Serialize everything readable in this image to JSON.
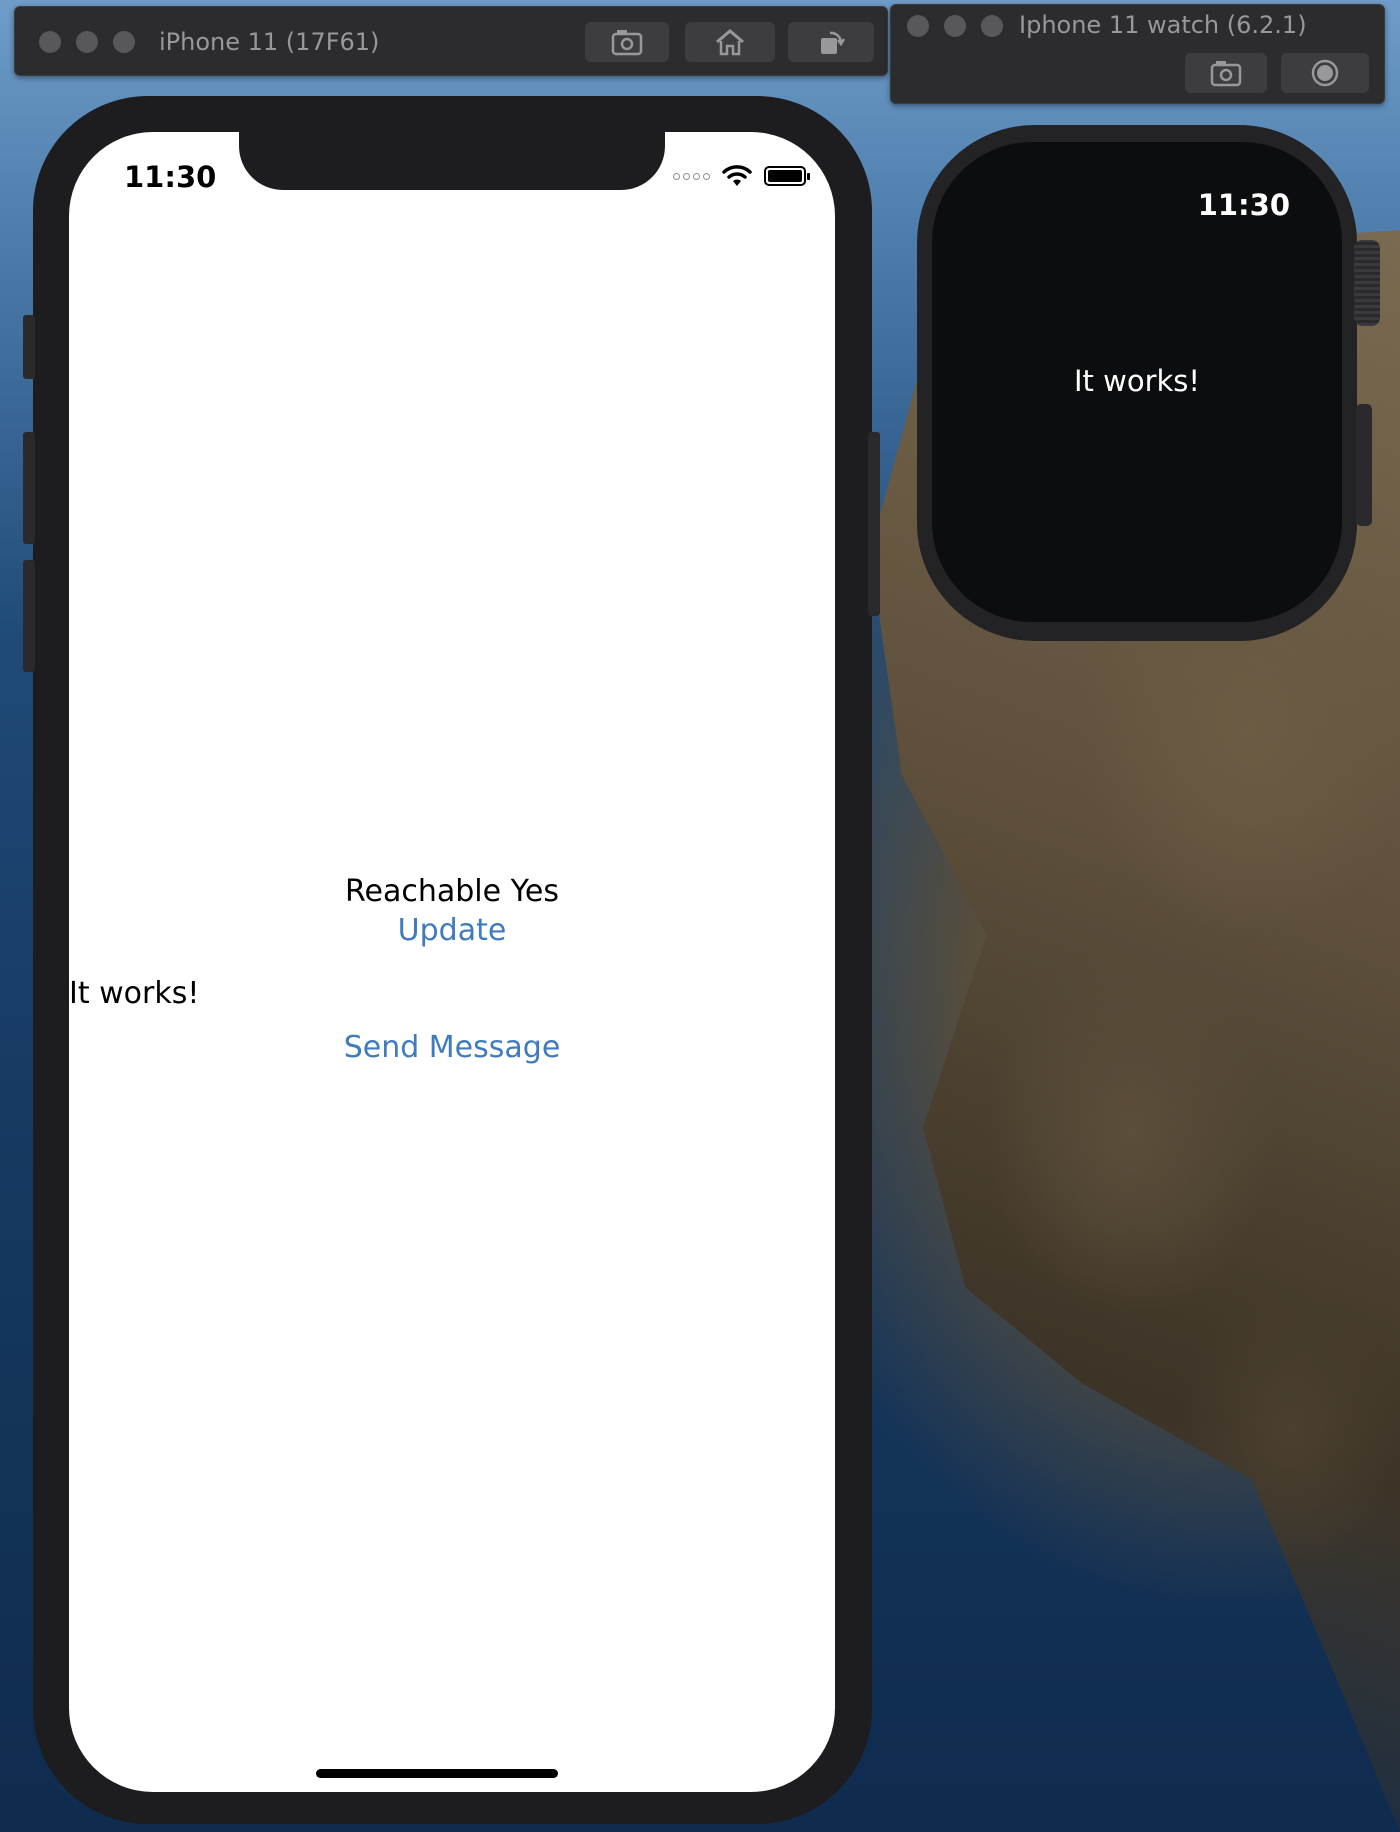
{
  "windows": {
    "phone_sim_title": "iPhone 11 (17F61)",
    "watch_sim_title": "Iphone 11 watch (6.2.1)"
  },
  "phone": {
    "status_time": "11:30",
    "reachable_label": "Reachable Yes",
    "update_button": "Update",
    "received_message": "It works!",
    "send_button": "Send Message"
  },
  "watch": {
    "time": "11:30",
    "message": "It works!"
  },
  "colors": {
    "link": "#3f7bbf",
    "toolbar": "#2c2c2e",
    "watch_screen": "#0c0d0f"
  },
  "icons": [
    "screenshot-icon",
    "home-icon",
    "rotate-icon",
    "record-icon",
    "wifi-icon",
    "battery-icon"
  ]
}
